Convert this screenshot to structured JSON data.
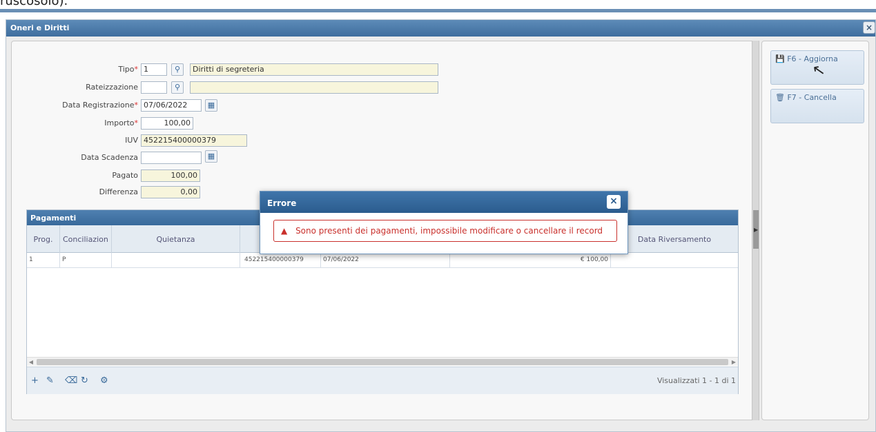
{
  "top_text": "ruscosolo).",
  "window": {
    "title": "Oneri e Diritti",
    "close_glyph": "×"
  },
  "form": {
    "tipo": {
      "label": "Tipo",
      "code": "1",
      "description": "Diritti di segreteria"
    },
    "rateizzazione": {
      "label": "Rateizzazione",
      "code": "",
      "description": ""
    },
    "data_registrazione": {
      "label": "Data Registrazione",
      "value": "07/06/2022"
    },
    "importo": {
      "label": "Importo",
      "value": "100,00"
    },
    "iuv": {
      "label": "IUV",
      "value": "452215400000379"
    },
    "data_scadenza": {
      "label": "Data Scadenza",
      "value": ""
    },
    "pagato": {
      "label": "Pagato",
      "value": "100,00"
    },
    "differenza": {
      "label": "Differenza",
      "value": "0,00"
    },
    "required_mark": "*"
  },
  "pagamenti": {
    "title": "Pagamenti",
    "columns": [
      "Prog.",
      "Conciliazion",
      "Quietanza",
      "",
      "",
      "",
      "Data Riversamento"
    ],
    "rows": [
      {
        "prog": "1",
        "conciliazione": "P",
        "quietanza": "",
        "iuv": "452215400000379",
        "data": "07/06/2022",
        "importo": "€ 100,00",
        "data_riversamento": ""
      }
    ],
    "pager": "Visualizzati 1 - 1 di 1"
  },
  "side_buttons": [
    {
      "label": "F6 - Aggiorna",
      "icon": "floppy-icon"
    },
    {
      "label": "F7 - Cancella",
      "icon": "trash-icon"
    }
  ],
  "dialog": {
    "title": "Errore",
    "close_glyph": "×",
    "warning_glyph": "▲",
    "message": "Sono presenti dei pagamenti, impossibile modificare o cancellare il record"
  },
  "colors": {
    "titlebar": "#4a7aab",
    "error": "#c9302c",
    "field_yellow": "#f7f5dc"
  }
}
